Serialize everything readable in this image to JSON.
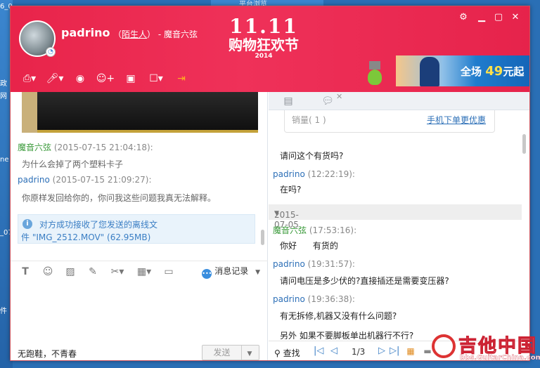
{
  "desktop": {
    "labels": [
      "6_0",
      "政",
      "网",
      "ne",
      "_07",
      "件"
    ],
    "top_fragment": "平台浏览"
  },
  "header": {
    "contact_name": "padrino",
    "relation_open": "（",
    "relation": "陌生人",
    "relation_close": "）",
    "relation_suffix": "- 魔音六弦",
    "promo_logo_top": "11.11",
    "promo_logo_mid": "购物狂欢节",
    "promo_logo_year": "2014",
    "ad_prefix": "全场",
    "ad_number": "49",
    "ad_suffix": "元起",
    "controls": {
      "settings": "⚙",
      "minimize": "▁",
      "maximize": "▢",
      "close": "✕"
    },
    "toolbar_icons": [
      "file-transfer-icon",
      "voice-call-icon",
      "video-call-icon",
      "add-contact-icon",
      "screen-share-icon",
      "app-icon",
      "exit-icon"
    ]
  },
  "left_chat": {
    "messages": [
      {
        "name": "魔音六弦",
        "time": "(2015-07-15 21:04:18):",
        "text": "为什么会掉了两个塑料卡子"
      },
      {
        "name": "padrino",
        "time": "(2015-07-15 21:09:27):",
        "text": "你原样发回给你的，你问我这些问题我真无法解释。"
      }
    ],
    "notice_line1": "对方成功接收了您发送的离线文",
    "notice_line2": "件 \"IMG_2512.MOV\" (62.95MB)",
    "notice_icon": "i",
    "history_label": "消息记录",
    "history_icon_text": "•••",
    "signature": "无跑鞋，不青春",
    "send_label": "发送",
    "send_arrow": "▼"
  },
  "right_chat": {
    "product_qty": "销量( 1 )",
    "product_link": "手机下单更优惠",
    "tab_close": "✕",
    "messages_top": [
      {
        "text": "请问这个有货吗?"
      },
      {
        "name": "padrino",
        "time": "(12:22:19):",
        "text": "在吗?"
      }
    ],
    "date": "2015-07-05",
    "messages_bottom": [
      {
        "name": "魔音六弦",
        "time": "(17:53:16):",
        "text": "你好      有货的"
      },
      {
        "name": "padrino",
        "time": "(19:31:57):",
        "text": "请问电压是多少伏的?直接插还是需要变压器?"
      },
      {
        "name": "padrino",
        "time": "(19:36:38):",
        "text": "有无拆修,机器又没有什么问题?"
      },
      {
        "text": "另外 如果不要脚板单出机器行不行?"
      }
    ],
    "find_label": "查找",
    "page_indicator": "1/3"
  },
  "watermark": {
    "cn": "吉他中国",
    "url": "bbs.GuitarChina.com"
  }
}
